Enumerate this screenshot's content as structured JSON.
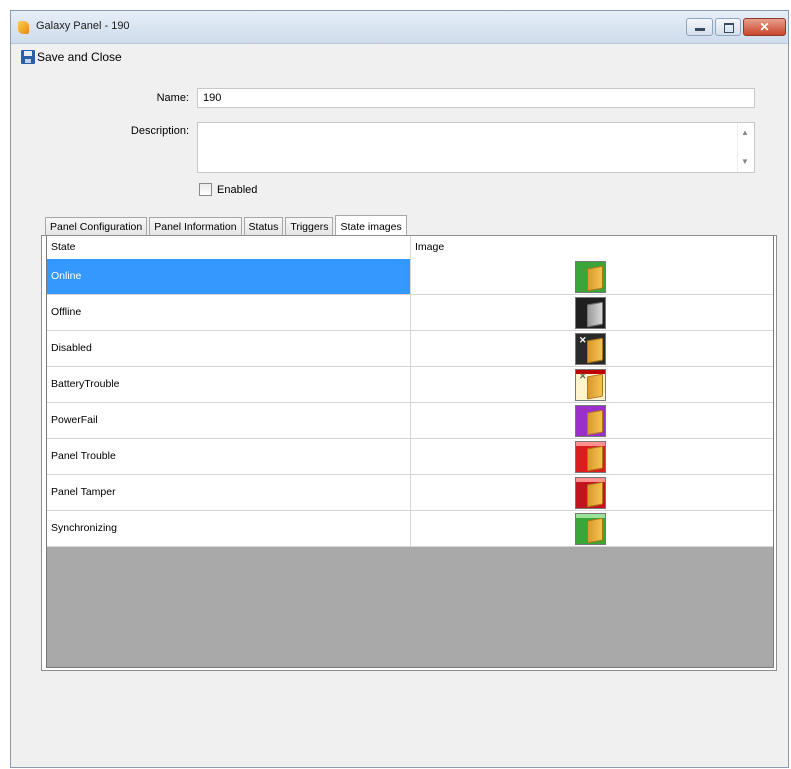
{
  "window": {
    "title": "Galaxy Panel  -  190"
  },
  "toolbar": {
    "save_label": "Save and Close"
  },
  "form": {
    "name_label": "Name:",
    "name_value": "190",
    "description_label": "Description:",
    "description_value": "",
    "enabled_label": "Enabled",
    "enabled_checked": false
  },
  "tabs": [
    {
      "label": "Panel Configuration"
    },
    {
      "label": "Panel Information"
    },
    {
      "label": "Status"
    },
    {
      "label": "Triggers"
    },
    {
      "label": "State images",
      "active": true
    }
  ],
  "grid": {
    "columns": [
      "State",
      "Image"
    ],
    "rows": [
      {
        "state": "Online",
        "icon": "door-online-icon",
        "bg": "#3aa63a",
        "mark": "",
        "bar": "",
        "selected": true
      },
      {
        "state": "Offline",
        "icon": "door-offline-icon",
        "bg": "#1f1f1f",
        "mark": "",
        "bar": "",
        "gray": true
      },
      {
        "state": "Disabled",
        "icon": "door-disabled-icon",
        "bg": "#2a2a2a",
        "mark": "✕",
        "bar": ""
      },
      {
        "state": "BatteryTrouble",
        "icon": "door-battery-trouble-icon",
        "bg": "#fff4cc",
        "mark": "✕",
        "bar": "#c00000"
      },
      {
        "state": "PowerFail",
        "icon": "door-power-fail-icon",
        "bg": "#9a2fc9",
        "mark": "",
        "bar": ""
      },
      {
        "state": "Panel Trouble",
        "icon": "door-panel-trouble-icon",
        "bg": "#d81e1e",
        "mark": "",
        "bar": "#ff9090"
      },
      {
        "state": "Panel Tamper",
        "icon": "door-panel-tamper-icon",
        "bg": "#c0141e",
        "mark": "",
        "bar": "#ff9090"
      },
      {
        "state": "Synchronizing",
        "icon": "door-synchronizing-icon",
        "bg": "#3aa63a",
        "mark": "",
        "bar": "#9be39b"
      }
    ]
  }
}
